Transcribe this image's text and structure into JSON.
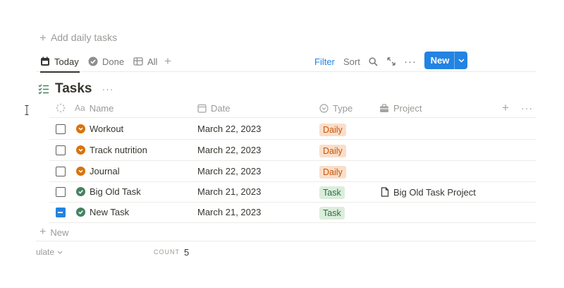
{
  "add_daily": {
    "label": "Add daily tasks"
  },
  "views": {
    "tabs": [
      {
        "label": "Today",
        "icon": "calendar-icon"
      },
      {
        "label": "Done",
        "icon": "check-circle-icon"
      },
      {
        "label": "All",
        "icon": "table-icon"
      }
    ],
    "filter_label": "Filter",
    "sort_label": "Sort",
    "new_label": "New"
  },
  "database": {
    "title": "Tasks",
    "more": "···"
  },
  "columns": {
    "name": "Name",
    "date": "Date",
    "type": "Type",
    "project": "Project"
  },
  "rows": [
    {
      "name": "Workout",
      "date": "March 22, 2023",
      "type": "Daily",
      "project": "",
      "status": "in-progress",
      "checked": false
    },
    {
      "name": "Track nutrition",
      "date": "March 22, 2023",
      "type": "Daily",
      "project": "",
      "status": "in-progress",
      "checked": false
    },
    {
      "name": "Journal",
      "date": "March 22, 2023",
      "type": "Daily",
      "project": "",
      "status": "in-progress",
      "checked": false
    },
    {
      "name": "Big Old Task",
      "date": "March 21, 2023",
      "type": "Task",
      "project": "Big Old Task Project",
      "status": "done",
      "checked": false
    },
    {
      "name": "New Task",
      "date": "March 21, 2023",
      "type": "Task",
      "project": "",
      "status": "done",
      "checked": true
    }
  ],
  "footer": {
    "new_label": "New",
    "calculate_label": "ulate",
    "count_label": "COUNT",
    "count_value": "5"
  },
  "colors": {
    "accent": "#2383e2",
    "status_in_progress": "#d9730d",
    "status_done": "#448361",
    "daily_bg": "#fadec9",
    "daily_text": "#c4570a",
    "task_bg": "#dbeddb",
    "task_text": "#2c6e4a"
  }
}
